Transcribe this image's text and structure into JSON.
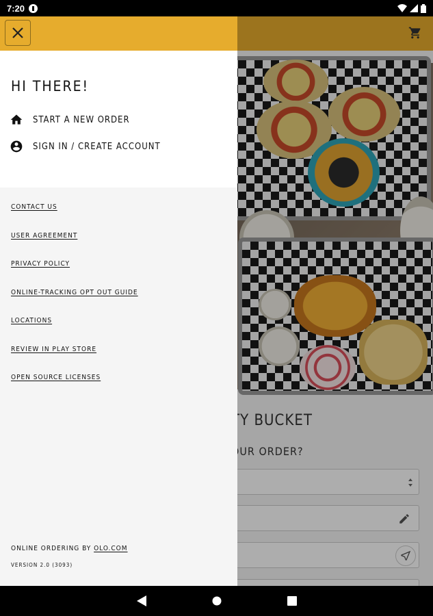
{
  "status_bar": {
    "time": "7:20"
  },
  "drawer": {
    "greeting": "HI THERE!",
    "menu": [
      {
        "label": "START A NEW ORDER",
        "icon": "home-icon"
      },
      {
        "label": "SIGN IN / CREATE ACCOUNT",
        "icon": "account-circle-icon"
      }
    ],
    "links": [
      "CONTACT US",
      "USER AGREEMENT",
      "PRIVACY POLICY",
      "ONLINE-TRACKING OPT OUT GUIDE",
      "LOCATIONS",
      "REVIEW IN PLAY STORE",
      "OPEN SOURCE LICENSES"
    ],
    "footer_prefix": "ONLINE ORDERING BY ",
    "footer_link": "OLO.COM",
    "version": "VERSION 2.0 (3093)"
  },
  "background": {
    "title_fragment": "TY BUCKET",
    "question_fragment": "OUR ORDER?"
  },
  "colors": {
    "accent": "#e6ac2d"
  }
}
